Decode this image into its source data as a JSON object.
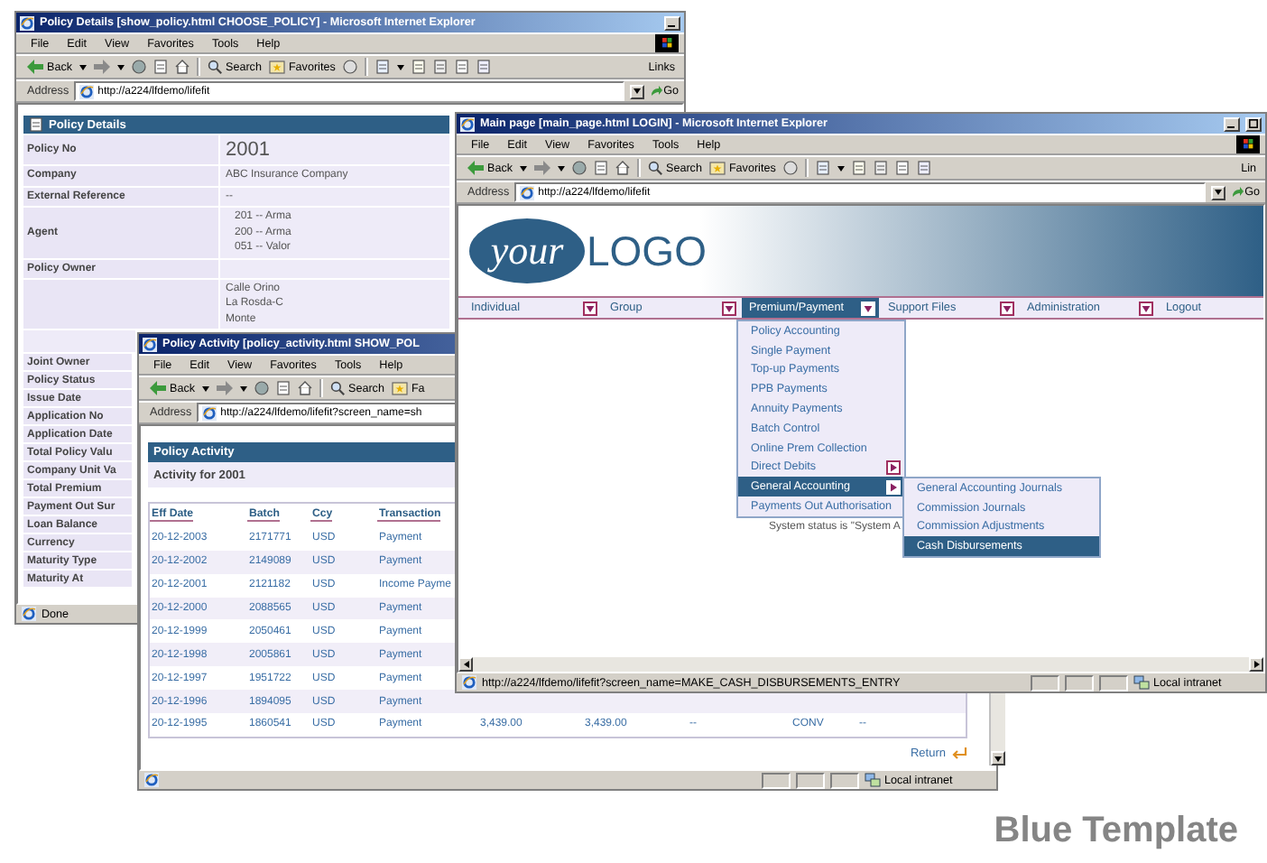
{
  "policy_window": {
    "title": "Policy Details [show_policy.html CHOOSE_POLICY] - Microsoft Internet Explorer",
    "controls": [
      {
        "kind": "minimize"
      }
    ],
    "menu": [
      "File",
      "Edit",
      "View",
      "Favorites",
      "Tools",
      "Help"
    ],
    "toolbar": [
      "Back",
      "Search",
      "Favorites"
    ],
    "extra_tools": true,
    "links": "Links",
    "address_label": "Address",
    "address": "http://a224/lfdemo/lifefit",
    "go": "Go",
    "panel_title": "Policy Details",
    "fields": [
      {
        "label": "Policy No",
        "values": [
          "2001"
        ],
        "kind": "large"
      },
      {
        "label": "Company",
        "values": [
          "ABC Insurance Company"
        ],
        "kind": "text"
      },
      {
        "label": "External Reference",
        "values": [
          "--"
        ],
        "kind": "text"
      },
      {
        "label": "Agent",
        "values": [
          "201 -- Arma",
          "200 -- Arma",
          "051 -- Valor"
        ],
        "kind": "text"
      },
      {
        "label": "Policy Owner"
      },
      {
        "values": [
          "Calle Orino",
          "La Rosda-C",
          "Monte"
        ],
        "kind": "text"
      }
    ],
    "more_labels": [
      "Joint Owner",
      "Policy Status",
      "Issue Date",
      "Application No",
      "Application Date",
      "Total Policy Valu",
      "Company Unit Va",
      "Total Premium",
      "Payment Out Sur",
      "Loan Balance",
      "Currency",
      "Maturity Type",
      "Maturity At"
    ],
    "status": {
      "text": "Done"
    }
  },
  "activity_window": {
    "title": "Policy Activity [policy_activity.html SHOW_POL",
    "menu": [
      "File",
      "Edit",
      "View",
      "Favorites",
      "Tools",
      "Help"
    ],
    "toolbar": [
      "Back",
      "Search",
      "Fa"
    ],
    "address_label": "Address",
    "address": "http://a224/lfdemo/lifefit?screen_name=sh",
    "panel_title": "Policy Activity",
    "subtitle": "Activity for 2001",
    "columns": [
      "Eff Date",
      "Batch",
      "Ccy",
      "Transaction"
    ],
    "rows": [
      [
        "20-12-2003",
        "2171771",
        "USD",
        "Payment"
      ],
      [
        "20-12-2002",
        "2149089",
        "USD",
        "Payment"
      ],
      [
        "20-12-2001",
        "2121182",
        "USD",
        "Income Payme"
      ],
      [
        "20-12-2000",
        "2088565",
        "USD",
        "Payment"
      ],
      [
        "20-12-1999",
        "2050461",
        "USD",
        "Payment"
      ],
      [
        "20-12-1998",
        "2005861",
        "USD",
        "Payment"
      ],
      [
        "20-12-1997",
        "1951722",
        "USD",
        "Payment"
      ],
      [
        "20-12-1996",
        "1894095",
        "USD",
        "Payment"
      ],
      [
        "20-12-1995",
        "1860541",
        "USD",
        "Payment",
        "3,439.00",
        "3,439.00",
        "--",
        "CONV",
        "--"
      ]
    ],
    "return_link": "Return",
    "status": {
      "zone": "Local intranet"
    }
  },
  "main_window": {
    "title": "Main page [main_page.html LOGIN] - Microsoft Internet Explorer",
    "controls": [
      {
        "kind": "minimize"
      },
      {
        "kind": "maximize"
      }
    ],
    "menu": [
      "File",
      "Edit",
      "View",
      "Favorites",
      "Tools",
      "Help"
    ],
    "toolbar": [
      "Back",
      "Search",
      "Favorites"
    ],
    "extra_tools": true,
    "links": "Lin",
    "address_label": "Address",
    "address": "http://a224/lfdemo/lifefit",
    "go": "Go",
    "logo": {
      "script": "your",
      "text": "LOGO"
    },
    "nav": [
      {
        "label": "Individual",
        "arrow": true,
        "selected": false
      },
      {
        "label": "Group",
        "arrow": true,
        "selected": false
      },
      {
        "label": "Premium/Payment",
        "arrow": true,
        "selected": true
      },
      {
        "label": "Support Files",
        "arrow": true,
        "selected": false
      },
      {
        "label": "Administration",
        "arrow": true,
        "selected": false
      },
      {
        "label": "Logout",
        "arrow": false,
        "selected": false
      }
    ],
    "dropdown": [
      {
        "label": "Policy Accounting",
        "submenu": false,
        "selected": false
      },
      {
        "label": "Single Payment",
        "submenu": false,
        "selected": false
      },
      {
        "label": "Top-up Payments",
        "submenu": false,
        "selected": false
      },
      {
        "label": "PPB Payments",
        "submenu": false,
        "selected": false
      },
      {
        "label": "Annuity Payments",
        "submenu": false,
        "selected": false
      },
      {
        "label": "Batch Control",
        "submenu": false,
        "selected": false
      },
      {
        "label": "Online Prem Collection",
        "submenu": false,
        "selected": false
      },
      {
        "label": "Direct Debits",
        "submenu": true,
        "selected": false
      },
      {
        "label": "General Accounting",
        "submenu": true,
        "selected": true
      },
      {
        "label": "Payments Out Authorisation",
        "submenu": false,
        "selected": false
      }
    ],
    "submenu": [
      {
        "label": "General Accounting Journals",
        "selected": false
      },
      {
        "label": "Commission Journals",
        "selected": false
      },
      {
        "label": "Commission Adjustments",
        "selected": false
      },
      {
        "label": "Cash Disbursements",
        "selected": true
      }
    ],
    "system_status": "System status is \"System A",
    "status": {
      "text": "http://a224/lfdemo/lifefit?screen_name=MAKE_CASH_DISBURSEMENTS_ENTRY",
      "zone": "Local intranet"
    }
  },
  "caption": "Blue Template"
}
